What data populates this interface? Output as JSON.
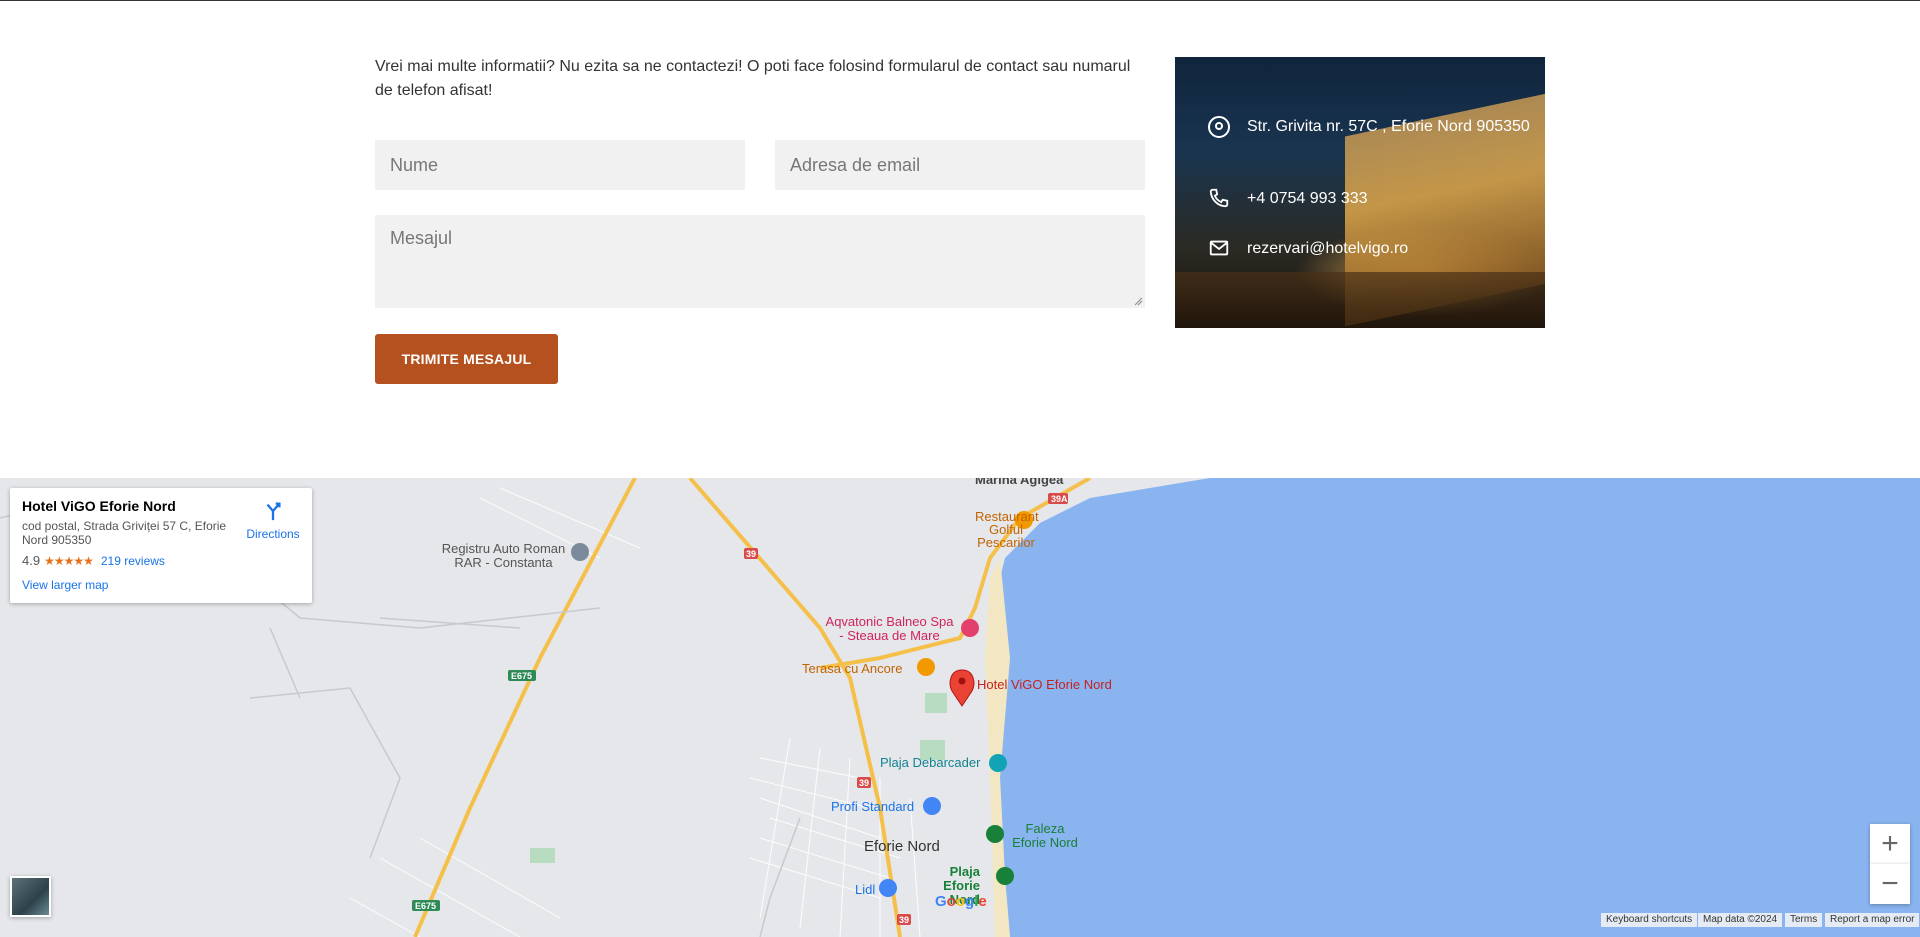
{
  "contact": {
    "intro": "Vrei mai multe informatii? Nu ezita sa ne contactezi! O poti face folosind formularul de contact sau numarul de telefon afisat!",
    "name_placeholder": "Nume",
    "email_placeholder": "Adresa de email",
    "message_placeholder": "Mesajul",
    "submit_label": "TRIMITE MESAJUL",
    "accent": "#b5501f"
  },
  "info": {
    "address": "Str. Grivita nr. 57C , Eforie Nord 905350",
    "phone": "+4 0754 993 333",
    "email": "rezervari@hotelvigo.ro",
    "icons": [
      "location-icon",
      "phone-icon",
      "mail-icon"
    ]
  },
  "map": {
    "card": {
      "title": "Hotel ViGO Eforie Nord",
      "address": "cod postal, Strada Griviței 57 C, Eforie Nord 905350",
      "rating": "4.9",
      "stars": "★★★★★",
      "reviews": "219 reviews",
      "directions": "Directions",
      "view_larger": "View larger map"
    },
    "labels": {
      "marina": "Marina Agigea",
      "restaurant": "Restaurant Golful Pescarilor",
      "registru": "Registru Auto Roman RAR - Constanta",
      "aqvatonic": "Aqvatonic Balneo Spa - Steaua de Mare",
      "terasa": "Terasa cu Ancore",
      "hotel": "Hotel ViGO Eforie Nord",
      "plaja_debarcader": "Plaja Debarcader",
      "profi": "Profi Standard",
      "eforie": "Eforie Nord",
      "faleza": "Faleza Eforie Nord",
      "plaja_eforie": "Plaja Eforie Nord",
      "lidl": "Lidl"
    },
    "road_shields": [
      "39A",
      "39",
      "E675",
      "39",
      "E675",
      "39"
    ],
    "zoom_in": "+",
    "zoom_out": "−",
    "attribution": {
      "shortcuts": "Keyboard shortcuts",
      "mapdata": "Map data ©2024",
      "terms": "Terms",
      "report": "Report a map error"
    },
    "google": "Google",
    "colors": {
      "water": "#8ab4f0",
      "land": "#e5e7ea",
      "road": "#f5c04a",
      "marker": "#ea4335"
    }
  }
}
